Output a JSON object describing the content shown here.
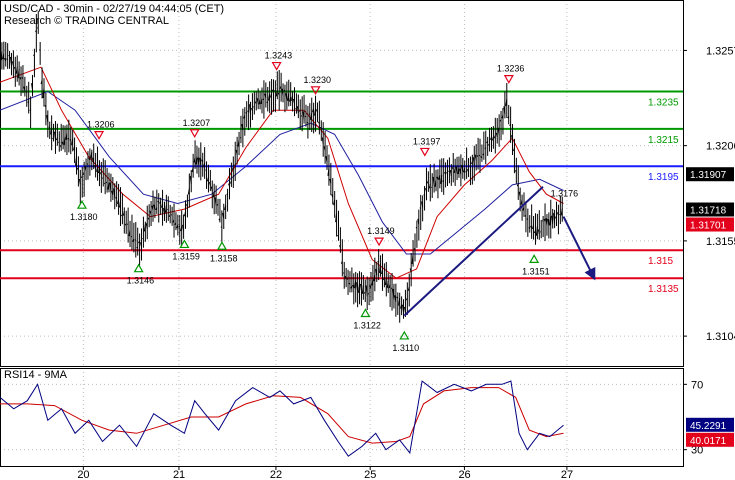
{
  "header": {
    "line1": "USD/CAD - 30min - 02/27/19 04:44:05 (CET)",
    "line2": "Research © TRADING CENTRAL"
  },
  "colors": {
    "support": "#e3001b",
    "resistance": "#009900",
    "pivot": "#1a1aff",
    "price": "#000000",
    "ma_fast": "#cc0000",
    "ma_slow": "#2020a0",
    "trend": "#1a1a80",
    "rsi": "#000080",
    "rsi_ma": "#cc0000",
    "grid": "#bdbdbd"
  },
  "chart_data": [
    {
      "type": "line",
      "title": "USD/CAD - 30min - 02/27/19 04:44:05 (CET)",
      "x_labels": [
        "20",
        "21",
        "22",
        "25",
        "26",
        "27"
      ],
      "y_ticks": [
        "1.3257",
        "1.3206",
        "1.3155",
        "1.3104"
      ],
      "ylim": [
        1.3088,
        1.3284
      ],
      "levels": [
        {
          "label": "1.3235",
          "value": 1.3235,
          "kind": "resistance"
        },
        {
          "label": "1.3215",
          "value": 1.3215,
          "kind": "resistance"
        },
        {
          "label": "1.3195",
          "value": 1.3195,
          "kind": "pivot"
        },
        {
          "label": "1.315",
          "value": 1.315,
          "kind": "support"
        },
        {
          "label": "1.3135",
          "value": 1.3135,
          "kind": "support"
        }
      ],
      "price_boxes": [
        {
          "label": "1.31907",
          "value": 1.31907,
          "color": "#000000"
        },
        {
          "label": "1.31718",
          "value": 1.31718,
          "color": "#000000"
        },
        {
          "label": "1.31701",
          "value": 1.31701,
          "color": "#e3001b"
        }
      ],
      "annotations": [
        {
          "label": "1.3243",
          "t": 0.405,
          "value": 1.3243,
          "marker": "down"
        },
        {
          "label": "1.3230",
          "t": 0.462,
          "value": 1.323,
          "marker": "down"
        },
        {
          "label": "1.3236",
          "t": 0.745,
          "value": 1.3236,
          "marker": "down"
        },
        {
          "label": "1.3206",
          "t": 0.145,
          "value": 1.3206,
          "marker": "down"
        },
        {
          "label": "1.3207",
          "t": 0.285,
          "value": 1.3207,
          "marker": "down"
        },
        {
          "label": "1.3197",
          "t": 0.622,
          "value": 1.3197,
          "marker": "down"
        },
        {
          "label": "1.3149",
          "t": 0.555,
          "value": 1.3149,
          "marker": "down"
        },
        {
          "label": "1.3180",
          "t": 0.12,
          "value": 1.318,
          "marker": "up"
        },
        {
          "label": "1.3146",
          "t": 0.203,
          "value": 1.3146,
          "marker": "up"
        },
        {
          "label": "1.3159",
          "t": 0.27,
          "value": 1.3159,
          "marker": "up"
        },
        {
          "label": "1.3158",
          "t": 0.325,
          "value": 1.3158,
          "marker": "up"
        },
        {
          "label": "1.3122",
          "t": 0.535,
          "value": 1.3122,
          "marker": "up"
        },
        {
          "label": "1.3110",
          "t": 0.592,
          "value": 1.311,
          "marker": "up"
        },
        {
          "label": "1.3151",
          "t": 0.782,
          "value": 1.3151,
          "marker": "up"
        },
        {
          "label": "1.3176",
          "t": 0.815,
          "value": 1.3176,
          "marker": "none"
        }
      ],
      "price": [
        [
          0.0,
          1.3255
        ],
        [
          0.02,
          1.325
        ],
        [
          0.035,
          1.324
        ],
        [
          0.045,
          1.3225
        ],
        [
          0.055,
          1.3275
        ],
        [
          0.062,
          1.324
        ],
        [
          0.072,
          1.3215
        ],
        [
          0.09,
          1.3208
        ],
        [
          0.105,
          1.3212
        ],
        [
          0.118,
          1.3185
        ],
        [
          0.135,
          1.32
        ],
        [
          0.15,
          1.319
        ],
        [
          0.17,
          1.318
        ],
        [
          0.19,
          1.316
        ],
        [
          0.205,
          1.3152
        ],
        [
          0.225,
          1.3175
        ],
        [
          0.25,
          1.317
        ],
        [
          0.268,
          1.316
        ],
        [
          0.285,
          1.32
        ],
        [
          0.3,
          1.3195
        ],
        [
          0.312,
          1.3182
        ],
        [
          0.325,
          1.3165
        ],
        [
          0.34,
          1.319
        ],
        [
          0.358,
          1.322
        ],
        [
          0.375,
          1.323
        ],
        [
          0.395,
          1.3232
        ],
        [
          0.41,
          1.3236
        ],
        [
          0.43,
          1.323
        ],
        [
          0.45,
          1.322
        ],
        [
          0.465,
          1.3225
        ],
        [
          0.478,
          1.32
        ],
        [
          0.492,
          1.317
        ],
        [
          0.505,
          1.3135
        ],
        [
          0.525,
          1.313
        ],
        [
          0.54,
          1.3128
        ],
        [
          0.555,
          1.3142
        ],
        [
          0.57,
          1.313
        ],
        [
          0.585,
          1.3122
        ],
        [
          0.595,
          1.3118
        ],
        [
          0.61,
          1.316
        ],
        [
          0.625,
          1.3185
        ],
        [
          0.645,
          1.3188
        ],
        [
          0.665,
          1.3192
        ],
        [
          0.69,
          1.3195
        ],
        [
          0.712,
          1.3205
        ],
        [
          0.73,
          1.3212
        ],
        [
          0.742,
          1.323
        ],
        [
          0.752,
          1.3205
        ],
        [
          0.762,
          1.3178
        ],
        [
          0.775,
          1.3165
        ],
        [
          0.788,
          1.316
        ],
        [
          0.8,
          1.3165
        ],
        [
          0.815,
          1.3168
        ],
        [
          0.825,
          1.3172
        ]
      ],
      "ma_fast": [
        [
          0.0,
          1.324
        ],
        [
          0.06,
          1.3248
        ],
        [
          0.09,
          1.3225
        ],
        [
          0.13,
          1.32
        ],
        [
          0.18,
          1.318
        ],
        [
          0.22,
          1.3168
        ],
        [
          0.27,
          1.3172
        ],
        [
          0.32,
          1.318
        ],
        [
          0.36,
          1.3205
        ],
        [
          0.4,
          1.3225
        ],
        [
          0.445,
          1.3225
        ],
        [
          0.48,
          1.321
        ],
        [
          0.51,
          1.3175
        ],
        [
          0.545,
          1.3145
        ],
        [
          0.58,
          1.3135
        ],
        [
          0.61,
          1.314
        ],
        [
          0.64,
          1.3168
        ],
        [
          0.68,
          1.3185
        ],
        [
          0.72,
          1.3198
        ],
        [
          0.75,
          1.321
        ],
        [
          0.775,
          1.3192
        ],
        [
          0.8,
          1.318
        ],
        [
          0.825,
          1.3175
        ]
      ],
      "ma_slow": [
        [
          0.0,
          1.3225
        ],
        [
          0.07,
          1.3235
        ],
        [
          0.11,
          1.3225
        ],
        [
          0.16,
          1.32
        ],
        [
          0.21,
          1.318
        ],
        [
          0.26,
          1.3175
        ],
        [
          0.31,
          1.318
        ],
        [
          0.36,
          1.3195
        ],
        [
          0.41,
          1.3212
        ],
        [
          0.455,
          1.3218
        ],
        [
          0.49,
          1.3212
        ],
        [
          0.525,
          1.319
        ],
        [
          0.56,
          1.3165
        ],
        [
          0.595,
          1.3148
        ],
        [
          0.63,
          1.3148
        ],
        [
          0.67,
          1.316
        ],
        [
          0.71,
          1.3172
        ],
        [
          0.75,
          1.3185
        ],
        [
          0.79,
          1.3188
        ],
        [
          0.825,
          1.3182
        ]
      ],
      "trend_lines": [
        {
          "from": [
            0.592,
            1.3115
          ],
          "to": [
            0.795,
            1.3184
          ],
          "arrow": false
        },
        {
          "from": [
            0.825,
            1.3168
          ],
          "to": [
            0.87,
            1.3135
          ],
          "arrow": true
        }
      ]
    },
    {
      "type": "line",
      "title": "RSI14 - 9MA",
      "y_ticks": [
        "70",
        "45.2291",
        "40.0171",
        "30"
      ],
      "ylim": [
        20,
        80
      ],
      "value_boxes": [
        {
          "label": "45.2291",
          "value": 45.2291,
          "color": "#000080"
        },
        {
          "label": "40.0171",
          "value": 40.0171,
          "color": "#e3001b"
        }
      ],
      "rsi": [
        [
          0.0,
          62
        ],
        [
          0.02,
          55
        ],
        [
          0.04,
          60
        ],
        [
          0.055,
          70
        ],
        [
          0.07,
          48
        ],
        [
          0.09,
          55
        ],
        [
          0.11,
          40
        ],
        [
          0.13,
          48
        ],
        [
          0.15,
          35
        ],
        [
          0.175,
          45
        ],
        [
          0.2,
          32
        ],
        [
          0.225,
          52
        ],
        [
          0.25,
          45
        ],
        [
          0.27,
          40
        ],
        [
          0.285,
          60
        ],
        [
          0.3,
          52
        ],
        [
          0.32,
          42
        ],
        [
          0.345,
          60
        ],
        [
          0.37,
          68
        ],
        [
          0.395,
          62
        ],
        [
          0.41,
          66
        ],
        [
          0.43,
          58
        ],
        [
          0.455,
          62
        ],
        [
          0.475,
          48
        ],
        [
          0.495,
          35
        ],
        [
          0.51,
          26
        ],
        [
          0.53,
          32
        ],
        [
          0.55,
          40
        ],
        [
          0.565,
          30
        ],
        [
          0.585,
          36
        ],
        [
          0.6,
          28
        ],
        [
          0.618,
          72
        ],
        [
          0.64,
          65
        ],
        [
          0.665,
          70
        ],
        [
          0.69,
          66
        ],
        [
          0.712,
          70
        ],
        [
          0.735,
          70
        ],
        [
          0.748,
          72
        ],
        [
          0.76,
          40
        ],
        [
          0.772,
          30
        ],
        [
          0.79,
          40
        ],
        [
          0.805,
          38
        ],
        [
          0.825,
          45
        ]
      ],
      "rsi_ma": [
        [
          0.0,
          58
        ],
        [
          0.04,
          58
        ],
        [
          0.08,
          57
        ],
        [
          0.12,
          48
        ],
        [
          0.16,
          42
        ],
        [
          0.2,
          40
        ],
        [
          0.24,
          45
        ],
        [
          0.28,
          50
        ],
        [
          0.32,
          50
        ],
        [
          0.36,
          58
        ],
        [
          0.4,
          63
        ],
        [
          0.44,
          62
        ],
        [
          0.48,
          52
        ],
        [
          0.51,
          38
        ],
        [
          0.545,
          34
        ],
        [
          0.58,
          35
        ],
        [
          0.6,
          38
        ],
        [
          0.62,
          58
        ],
        [
          0.65,
          66
        ],
        [
          0.69,
          68
        ],
        [
          0.73,
          68
        ],
        [
          0.755,
          62
        ],
        [
          0.775,
          42
        ],
        [
          0.8,
          38
        ],
        [
          0.825,
          40
        ]
      ]
    }
  ]
}
